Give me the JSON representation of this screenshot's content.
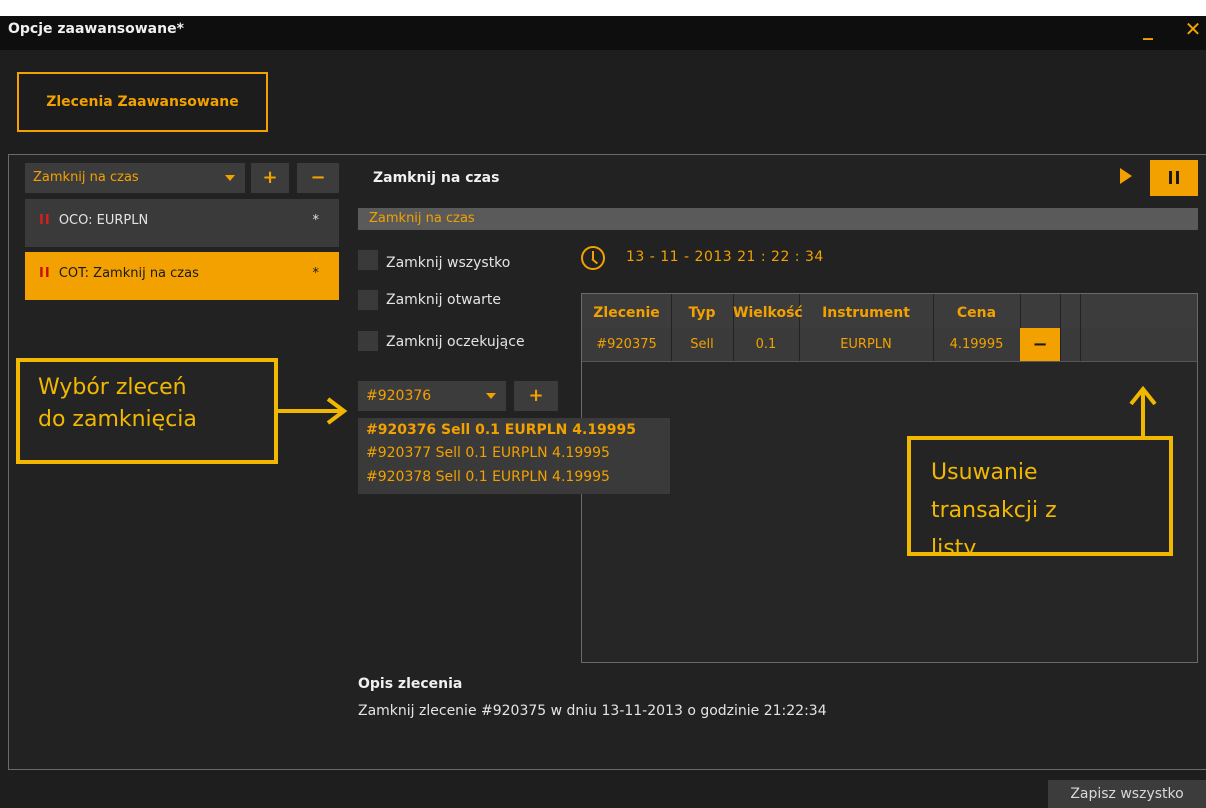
{
  "window": {
    "title": "Opcje zaawansowane*",
    "minimize_icon": "minimize-icon",
    "close_icon": "close-icon"
  },
  "tab": {
    "label": "Zlecenia Zaawansowane"
  },
  "left": {
    "combo_value": "Zamknij na czas",
    "plus_label": "+",
    "minus_label": "−",
    "items": [
      {
        "bars": "II",
        "label": "OCO: EURPLN",
        "star": "*",
        "selected": false
      },
      {
        "bars": "II",
        "label": "COT: Zamknij na czas",
        "star": "*",
        "selected": true
      }
    ]
  },
  "main": {
    "title": "Zamknij na czas",
    "header_bar": "Zamknij na czas",
    "play_icon": "play-icon",
    "pause_icon": "pause-icon",
    "checkboxes": [
      {
        "label": "Zamknij wszystko",
        "checked": false
      },
      {
        "label": "Zamknij otwarte",
        "checked": false
      },
      {
        "label": "Zamknij oczekujące",
        "checked": false
      }
    ],
    "datetime": "13 - 11 - 2013  21 : 22 : 34",
    "table": {
      "headers": [
        "Zlecenie",
        "Typ",
        "Wielkość",
        "Instrument",
        "Cena"
      ],
      "rows": [
        {
          "order": "#920375",
          "type": "Sell",
          "size": "0.1",
          "instrument": "EURPLN",
          "price": "4.19995",
          "remove": "−"
        }
      ]
    },
    "order_select": {
      "value": "#920376",
      "plus_label": "+",
      "options": [
        "#920376 Sell 0.1 EURPLN 4.19995",
        "#920377 Sell 0.1 EURPLN 4.19995",
        "#920378 Sell 0.1 EURPLN 4.19995"
      ]
    },
    "description": {
      "title": "Opis zlecenia",
      "text": "Zamknij zlecenie #920375  w dniu 13-11-2013 o godzinie 21:22:34"
    }
  },
  "footer": {
    "save_label": "Zapisz wszystko"
  },
  "callouts": {
    "left_line1": "Wybór zleceń",
    "left_line2": "do zamknięcia",
    "right_line1": "Usuwanie",
    "right_line2": "transakcji z",
    "right_line3": "listy"
  },
  "colors": {
    "accent": "#f2a100",
    "background": "#1e1e1e",
    "callout": "#f2b800"
  }
}
